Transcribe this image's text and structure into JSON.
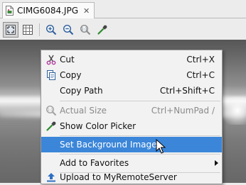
{
  "tab": {
    "title": "CIMG6084.JPG",
    "close": "✕"
  },
  "toolbar": {
    "buttons": [
      "fit-screen-icon",
      "actual-grid-icon",
      "zoom-in-icon",
      "zoom-out-icon",
      "actual-size-icon",
      "color-picker-icon"
    ]
  },
  "menu": {
    "items": [
      {
        "label": "Cut",
        "mnemonic_index": 2,
        "shortcut": "Ctrl+X",
        "icon": "scissors-icon",
        "enabled": true
      },
      {
        "label": "Copy",
        "shortcut": "Ctrl+C",
        "icon": "copy-icon",
        "enabled": true
      },
      {
        "label": "Copy Path",
        "shortcut": "Ctrl+Shift+C",
        "icon": "",
        "enabled": true
      },
      {
        "label": "Actual Size",
        "shortcut": "Ctrl+NumPad /",
        "icon": "actual-size-icon",
        "enabled": false
      },
      {
        "label": "Show Color Picker",
        "shortcut": "",
        "icon": "color-picker-icon",
        "enabled": true
      },
      {
        "label": "Set Background Image",
        "shortcut": "",
        "icon": "",
        "enabled": true,
        "highlighted": true
      },
      {
        "label": "Add to Favorites",
        "shortcut": "",
        "icon": "",
        "enabled": true,
        "submenu": true
      },
      {
        "label": "Upload to MyRemoteServer",
        "shortcut": "",
        "icon": "upload-icon",
        "enabled": true
      }
    ]
  },
  "colors": {
    "highlight": "#3b86d9",
    "menu_bg": "#f2f2f2",
    "disabled_text": "#8a8a8a"
  }
}
